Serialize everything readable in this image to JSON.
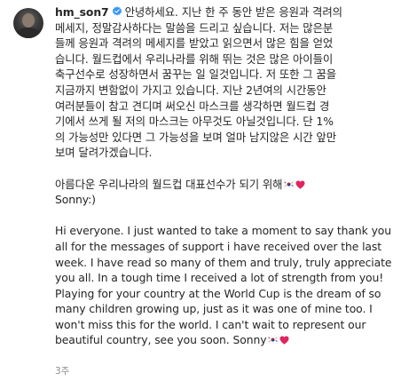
{
  "post": {
    "username": "hm_son7",
    "korean": {
      "line1": "안녕하세요. 지난 한 주 동안 받은 응원과 격려의",
      "line2": "메세지, 정말감사하다는 말씀을 드리고 싶습니다. 저는 많은분",
      "line3": "들께 응원과 격려의 메세지를 받았고 읽으면서 많은 힘을 얻었",
      "line4": "습니다. 월드컵에서 우리나라를 위해 뛰는 것은 많은 아이들이",
      "line5": "축구선수로 성장하면서 꿈꾸는 일 일것입니다. 저 또한 그 꿈을",
      "line6": "지금까지 변함없이 가지고 있습니다. 지난 2년여의 시간동안",
      "line7": "여러분들이 참고 견디며 써오신 마스크를 생각하면 월드컵 경",
      "line8": "기에서 쓰게 될 저의 마스크는 아무것도 아닐것입니다. 단 1%",
      "line9": "의 가능성만 있다면 그 가능성을 보며 얼마 남지않은 시간 앞만",
      "line10": "보며 달려가겠습니다."
    },
    "korean_closing": "아름다운 우리나라의 월드컵 대표선수가 되기 위해",
    "sign_off": "Sonny:)",
    "english": {
      "line1": "Hi everyone. I just wanted to take a moment to say thank you",
      "line2": "all for the messages of support i have received over the last",
      "line3": "week. I have read so many of them and truly, truly appreciate",
      "line4": "you all. In a tough time I received a lot of strength from you!",
      "line5": "Playing for your country at the World Cup is the dream of so",
      "line6": "many children growing up, just as it was one of mine too. I",
      "line7": "won't miss this for the world. I can't wait to represent our",
      "line8": "beautiful country, see you soon. Sonny"
    },
    "timestamp": "3주"
  },
  "icons": {
    "verified": "verified-badge-icon",
    "flag": "south-korea-flag-icon",
    "heart": "red-heart-icon"
  },
  "colors": {
    "text": "#262626",
    "muted": "#8e8e8e",
    "verified_blue": "#3897f0",
    "heart_red": "#e0245e"
  }
}
